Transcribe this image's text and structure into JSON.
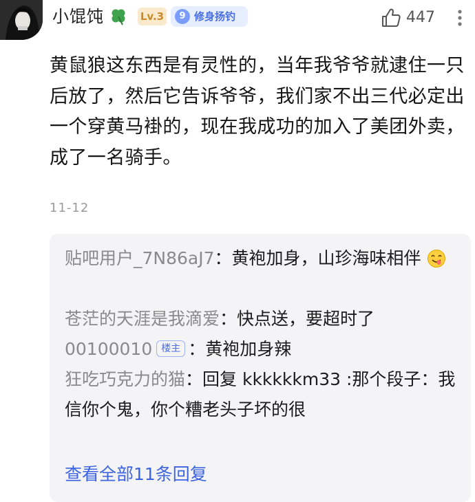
{
  "header": {
    "username": "小馄饨",
    "level_badge": "Lv.3",
    "title_badge_number": "9",
    "title_badge_text": "修身扬钓",
    "like_count": "447",
    "clover_icon": "clover-icon",
    "thumb_icon": "thumb-up-icon",
    "more_icon": "more-vertical-icon",
    "colors": {
      "level_badge_bg": "#fbe9cc",
      "level_badge_text": "#c88a2c",
      "title_badge_bg": "#e6eeff",
      "title_badge_text": "#4a6fe0"
    }
  },
  "comment": {
    "text": "黄鼠狼这东西是有灵性的，当年我爷爷就逮住一只后放了，然后它告诉爷爷，我们家不出三代必定出一个穿黄马褂的，现在我成功的加入了美团外卖，成了一名骑手。",
    "date": "11-12"
  },
  "replies": {
    "items": [
      {
        "author": "贴吧用户_7N86aJ7",
        "separator": "：",
        "text": "黄袍加身，山珍海味相伴",
        "emoji": "yum-face-emoji"
      },
      {
        "author": "苍茫的天涯是我滴爱",
        "separator": "：",
        "text": "快点送，要超时了"
      },
      {
        "author": "00100010",
        "tag": "楼主",
        "separator": "：",
        "text": "黄袍加身辣"
      },
      {
        "author": "狂吃巧克力的猫",
        "separator": "：",
        "text": "回复 kkkkkkm33 :那个段子：我信你个鬼，你个糟老头子坏的很"
      }
    ],
    "view_all": "查看全部11条回复",
    "colors": {
      "author": "#8a8a8a",
      "link": "#3d64e0",
      "box_bg": "#f4f4f6"
    }
  }
}
